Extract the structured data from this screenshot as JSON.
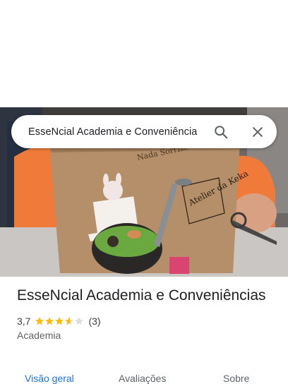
{
  "search": {
    "query": "EsseNcial Academia e Conveniência"
  },
  "icons": {
    "search": "search-icon",
    "close": "close-icon",
    "star": "star-icon"
  },
  "place": {
    "name": "EsseNcial Academia e Conveniências",
    "rating": "3,7",
    "rating_value": 3.7,
    "reviews": "(3)",
    "category": "Academia"
  },
  "tabs": [
    {
      "label": "Visão geral",
      "active": true
    },
    {
      "label": "Avaliações",
      "active": false
    },
    {
      "label": "Sobre",
      "active": false
    }
  ],
  "photo": {
    "bag_text": "Atelier da Keka"
  },
  "colors": {
    "accent": "#1a73e8",
    "star": "#fbbc04",
    "star_empty": "#dadce0"
  }
}
